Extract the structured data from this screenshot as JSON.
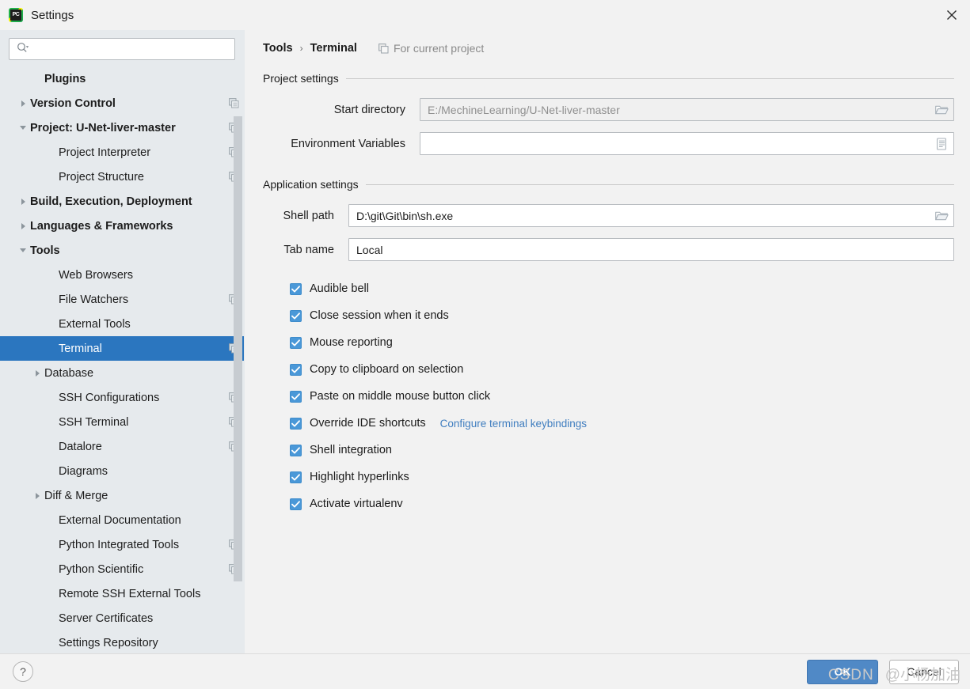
{
  "window": {
    "title": "Settings",
    "app_icon": "pycharm-icon",
    "close_icon": "close-icon"
  },
  "search": {
    "placeholder": "",
    "value": "",
    "icon": "search-icon"
  },
  "sidebar": {
    "items": [
      {
        "label": "Plugins",
        "indent": 1,
        "arrow": "none",
        "bold": true,
        "copy": false,
        "selected": false
      },
      {
        "label": "Version Control",
        "indent": 0,
        "arrow": "right",
        "bold": true,
        "copy": true,
        "selected": false
      },
      {
        "label": "Project: U-Net-liver-master",
        "indent": 0,
        "arrow": "down",
        "bold": true,
        "copy": true,
        "selected": false
      },
      {
        "label": "Project Interpreter",
        "indent": 2,
        "arrow": "none",
        "bold": false,
        "copy": true,
        "selected": false
      },
      {
        "label": "Project Structure",
        "indent": 2,
        "arrow": "none",
        "bold": false,
        "copy": true,
        "selected": false
      },
      {
        "label": "Build, Execution, Deployment",
        "indent": 0,
        "arrow": "right",
        "bold": true,
        "copy": false,
        "selected": false
      },
      {
        "label": "Languages & Frameworks",
        "indent": 0,
        "arrow": "right",
        "bold": true,
        "copy": false,
        "selected": false
      },
      {
        "label": "Tools",
        "indent": 0,
        "arrow": "down",
        "bold": true,
        "copy": false,
        "selected": false
      },
      {
        "label": "Web Browsers",
        "indent": 2,
        "arrow": "none",
        "bold": false,
        "copy": false,
        "selected": false
      },
      {
        "label": "File Watchers",
        "indent": 2,
        "arrow": "none",
        "bold": false,
        "copy": true,
        "selected": false
      },
      {
        "label": "External Tools",
        "indent": 2,
        "arrow": "none",
        "bold": false,
        "copy": false,
        "selected": false
      },
      {
        "label": "Terminal",
        "indent": 2,
        "arrow": "none",
        "bold": false,
        "copy": true,
        "selected": true
      },
      {
        "label": "Database",
        "indent": 1,
        "arrow": "right",
        "bold": false,
        "copy": false,
        "selected": false
      },
      {
        "label": "SSH Configurations",
        "indent": 2,
        "arrow": "none",
        "bold": false,
        "copy": true,
        "selected": false
      },
      {
        "label": "SSH Terminal",
        "indent": 2,
        "arrow": "none",
        "bold": false,
        "copy": true,
        "selected": false
      },
      {
        "label": "Datalore",
        "indent": 2,
        "arrow": "none",
        "bold": false,
        "copy": true,
        "selected": false
      },
      {
        "label": "Diagrams",
        "indent": 2,
        "arrow": "none",
        "bold": false,
        "copy": false,
        "selected": false
      },
      {
        "label": "Diff & Merge",
        "indent": 1,
        "arrow": "right",
        "bold": false,
        "copy": false,
        "selected": false
      },
      {
        "label": "External Documentation",
        "indent": 2,
        "arrow": "none",
        "bold": false,
        "copy": false,
        "selected": false
      },
      {
        "label": "Python Integrated Tools",
        "indent": 2,
        "arrow": "none",
        "bold": false,
        "copy": true,
        "selected": false
      },
      {
        "label": "Python Scientific",
        "indent": 2,
        "arrow": "none",
        "bold": false,
        "copy": true,
        "selected": false
      },
      {
        "label": "Remote SSH External Tools",
        "indent": 2,
        "arrow": "none",
        "bold": false,
        "copy": false,
        "selected": false
      },
      {
        "label": "Server Certificates",
        "indent": 2,
        "arrow": "none",
        "bold": false,
        "copy": false,
        "selected": false
      },
      {
        "label": "Settings Repository",
        "indent": 2,
        "arrow": "none",
        "bold": false,
        "copy": false,
        "selected": false
      }
    ]
  },
  "breadcrumb": {
    "parent": "Tools",
    "separator": "›",
    "current": "Terminal",
    "scope_label": "For current project",
    "scope_icon": "copy-icon"
  },
  "project_settings": {
    "group_title": "Project settings",
    "fields": [
      {
        "label": "Start directory",
        "value": "E:/MechineLearning/U-Net-liver-master",
        "placeholder": "",
        "disabled": true,
        "trailing_icon": "folder-open-icon"
      },
      {
        "label": "Environment Variables",
        "value": "",
        "placeholder": "",
        "disabled": false,
        "trailing_icon": "list-document-icon"
      }
    ]
  },
  "application_settings": {
    "group_title": "Application settings",
    "fields": [
      {
        "label": "Shell path",
        "value": "D:\\git\\Git\\bin\\sh.exe",
        "placeholder": "",
        "disabled": false,
        "trailing_icon": "folder-open-icon"
      },
      {
        "label": "Tab name",
        "value": "Local",
        "placeholder": "",
        "disabled": false,
        "trailing_icon": "none"
      }
    ],
    "checkboxes": [
      {
        "label": "Audible bell",
        "checked": true,
        "link": ""
      },
      {
        "label": "Close session when it ends",
        "checked": true,
        "link": ""
      },
      {
        "label": "Mouse reporting",
        "checked": true,
        "link": ""
      },
      {
        "label": "Copy to clipboard on selection",
        "checked": true,
        "link": ""
      },
      {
        "label": "Paste on middle mouse button click",
        "checked": true,
        "link": ""
      },
      {
        "label": "Override IDE shortcuts",
        "checked": true,
        "link": "Configure terminal keybindings"
      },
      {
        "label": "Shell integration",
        "checked": true,
        "link": ""
      },
      {
        "label": "Highlight hyperlinks",
        "checked": true,
        "link": ""
      },
      {
        "label": "Activate virtualenv",
        "checked": true,
        "link": ""
      }
    ]
  },
  "footer": {
    "help_label": "?",
    "ok_label": "OK",
    "cancel_label": "Cancel"
  },
  "watermark": {
    "site": "CSDN",
    "handle": "@小杨加油"
  },
  "colors": {
    "selection_blue": "#2b76bf",
    "checkbox_blue": "#4a98d8",
    "primary_button": "#5089c6",
    "link_blue": "#3f7dbf",
    "sidebar_bg": "#e6eaed",
    "content_bg": "#f2f2f2"
  }
}
